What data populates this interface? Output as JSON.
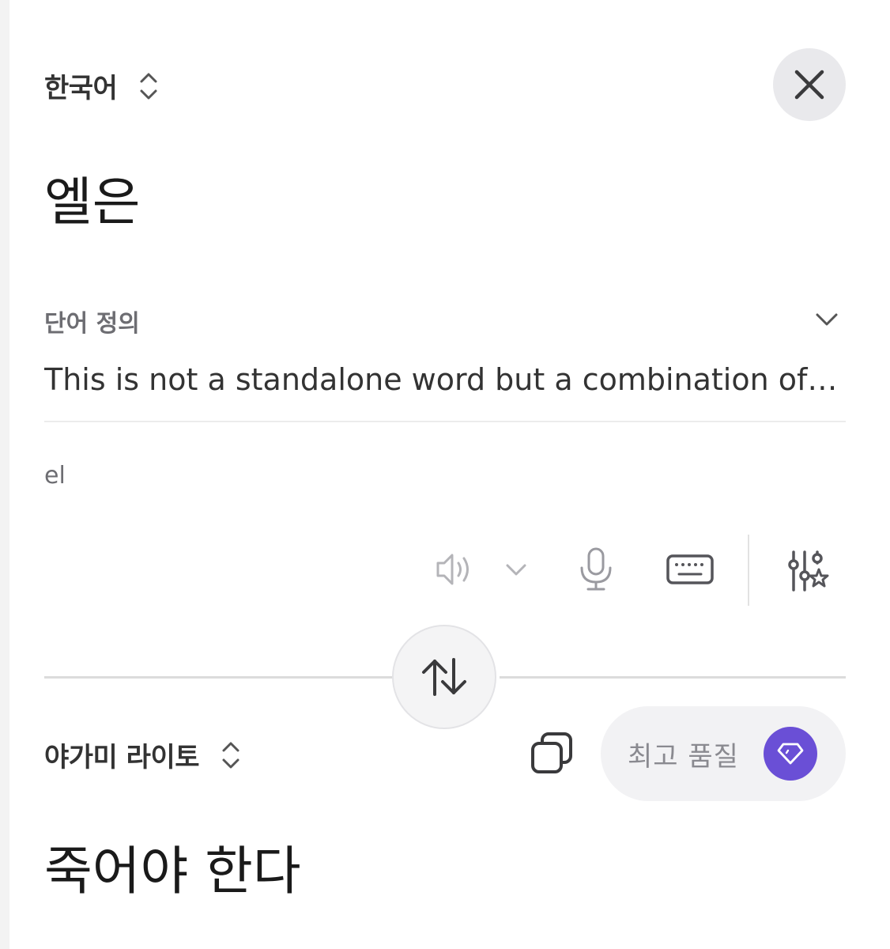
{
  "source": {
    "language": "한국어",
    "text": "엘은"
  },
  "definition": {
    "title": "단어 정의",
    "text": "This is not a standalone word but a combination of the…"
  },
  "romanization": "el",
  "target": {
    "language": "야가미 라이토",
    "text": "죽어야 한다",
    "quality_label": "최고 품질"
  },
  "colors": {
    "accent": "#6a4fd6",
    "icon_gray": "#8a8a90"
  }
}
